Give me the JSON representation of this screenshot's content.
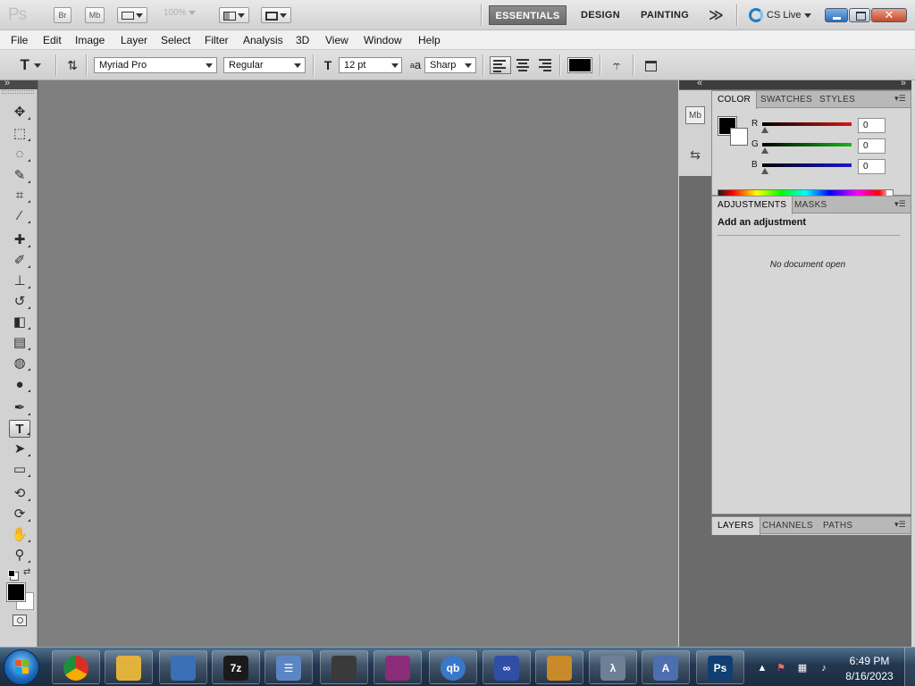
{
  "appbar": {
    "logo": "Ps",
    "bridge": "Br",
    "minibridge": "Mb",
    "zoom": "100%",
    "workspaces": [
      "ESSENTIALS",
      "DESIGN",
      "PAINTING"
    ],
    "more": "≫",
    "cslive": "CS Live",
    "close": "✕"
  },
  "menu": [
    "File",
    "Edit",
    "Image",
    "Layer",
    "Select",
    "Filter",
    "Analysis",
    "3D",
    "View",
    "Window",
    "Help"
  ],
  "options": {
    "tool_glyph": "T",
    "font_family": "Myriad Pro",
    "font_style": "Regular",
    "font_size": "12 pt",
    "aa_label": "a",
    "aa_label2": "a",
    "anti_alias": "Sharp",
    "text_color": "#000000"
  },
  "tools": [
    {
      "name": "move-tool",
      "glyph": "✥"
    },
    {
      "name": "marquee-tool",
      "glyph": "⬚"
    },
    {
      "name": "lasso-tool",
      "glyph": "◌"
    },
    {
      "name": "quick-selection-tool",
      "glyph": "✎"
    },
    {
      "name": "crop-tool",
      "glyph": "⌗"
    },
    {
      "name": "eyedropper-tool",
      "glyph": "⁄"
    },
    {
      "name": "healing-brush-tool",
      "glyph": "✚"
    },
    {
      "name": "brush-tool",
      "glyph": "✐"
    },
    {
      "name": "clone-stamp-tool",
      "glyph": "⊥"
    },
    {
      "name": "history-brush-tool",
      "glyph": "↺"
    },
    {
      "name": "eraser-tool",
      "glyph": "◧"
    },
    {
      "name": "gradient-tool",
      "glyph": "▤"
    },
    {
      "name": "blur-tool",
      "glyph": "◍"
    },
    {
      "name": "dodge-tool",
      "glyph": "●"
    },
    {
      "name": "pen-tool",
      "glyph": "✒"
    },
    {
      "name": "type-tool",
      "glyph": "T"
    },
    {
      "name": "path-selection-tool",
      "glyph": "➤"
    },
    {
      "name": "rectangle-tool",
      "glyph": "▭"
    },
    {
      "name": "3d-rotate-tool",
      "glyph": "⟲"
    },
    {
      "name": "3d-orbit-tool",
      "glyph": "⟳"
    },
    {
      "name": "hand-tool",
      "glyph": "✋"
    },
    {
      "name": "zoom-tool",
      "glyph": "⚲"
    }
  ],
  "dock": {
    "minibridge": "Mb",
    "history": "⇆"
  },
  "color_panel": {
    "tabs": [
      "COLOR",
      "SWATCHES",
      "STYLES"
    ],
    "foreground": "#000000",
    "background": "#ffffff",
    "channels": [
      {
        "label": "R",
        "value": "0",
        "color": "#d61818"
      },
      {
        "label": "G",
        "value": "0",
        "color": "#14b814"
      },
      {
        "label": "B",
        "value": "0",
        "color": "#1818d6"
      }
    ]
  },
  "adjustments_panel": {
    "tabs": [
      "ADJUSTMENTS",
      "MASKS"
    ],
    "title": "Add an adjustment",
    "message": "No document open"
  },
  "layers_panel": {
    "tabs": [
      "LAYERS",
      "CHANNELS",
      "PATHS"
    ]
  },
  "taskbar": {
    "apps": [
      {
        "name": "chrome",
        "label": "",
        "color": "#d93025"
      },
      {
        "name": "file-explorer",
        "label": "",
        "color": "#e3b23c"
      },
      {
        "name": "network",
        "label": "",
        "color": "#3b6fb6"
      },
      {
        "name": "7zip",
        "label": "7z",
        "color": "#1a1a1a"
      },
      {
        "name": "notepad-list",
        "label": "☰",
        "color": "#5b86c4"
      },
      {
        "name": "app-cat",
        "label": "",
        "color": "#3a3a3a"
      },
      {
        "name": "winrar",
        "label": "",
        "color": "#8b2c78"
      },
      {
        "name": "qbittorrent",
        "label": "qb",
        "color": "#3a77c9"
      },
      {
        "name": "app-infinity",
        "label": "∞",
        "color": "#2f4ea6"
      },
      {
        "name": "app-tools",
        "label": "",
        "color": "#c98a2b"
      },
      {
        "name": "app-lambda",
        "label": "λ",
        "color": "#6e7f96"
      },
      {
        "name": "app-triangle",
        "label": "A",
        "color": "#4d6fb0"
      },
      {
        "name": "photoshop",
        "label": "Ps",
        "color": "#0f3f73"
      }
    ],
    "time": "6:49 PM",
    "date": "8/16/2023"
  }
}
